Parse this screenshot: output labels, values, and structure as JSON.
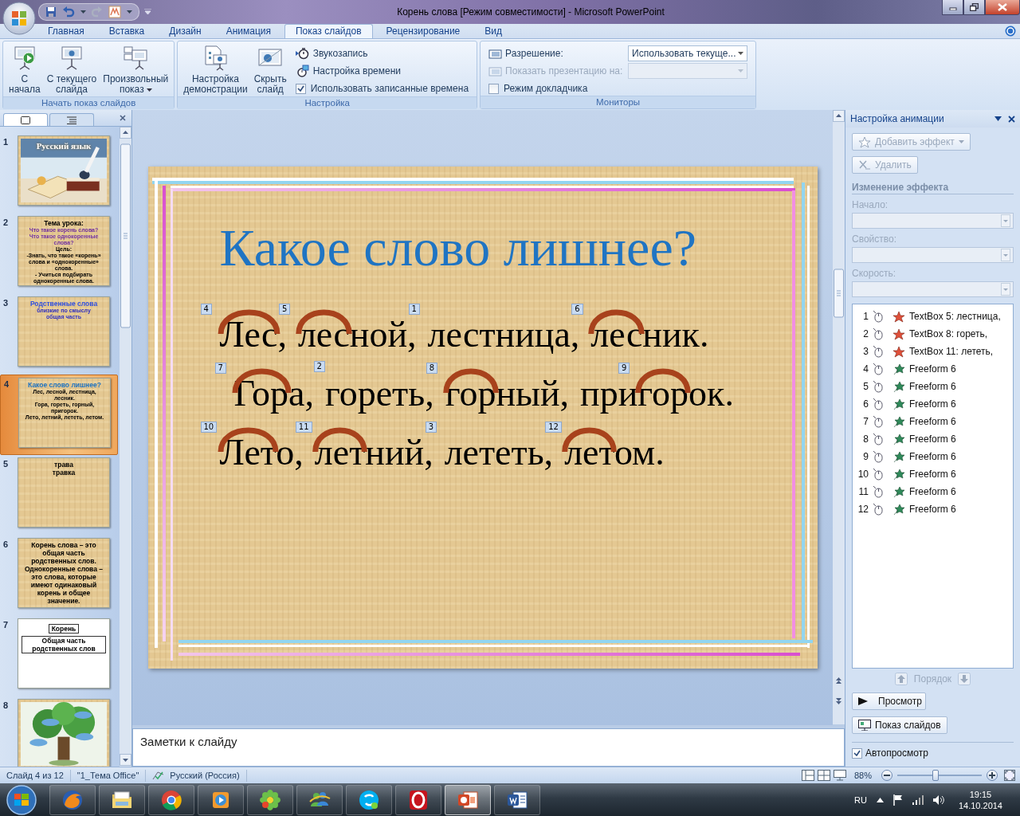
{
  "window": {
    "title": "Корень слова [Режим совместимости] - Microsoft PowerPoint"
  },
  "ribbon": {
    "tabs": [
      {
        "label": "Главная",
        "selected": false
      },
      {
        "label": "Вставка",
        "selected": false
      },
      {
        "label": "Дизайн",
        "selected": false
      },
      {
        "label": "Анимация",
        "selected": false
      },
      {
        "label": "Показ слайдов",
        "selected": true
      },
      {
        "label": "Рецензирование",
        "selected": false
      },
      {
        "label": "Вид",
        "selected": false
      }
    ],
    "groups": [
      {
        "title": "Начать показ слайдов",
        "items": [
          {
            "kind": "large",
            "label": "С\nначала"
          },
          {
            "kind": "large",
            "label": "С текущего\nслайда"
          },
          {
            "kind": "large",
            "label": "Произвольный\nпоказ",
            "dropdown": true
          }
        ]
      },
      {
        "title": "Настройка",
        "items": [
          {
            "kind": "large",
            "label": "Настройка\nдемонстрации"
          },
          {
            "kind": "large",
            "label": "Скрыть\nслайд"
          },
          {
            "kind": "stack",
            "items": [
              {
                "kind": "small",
                "label": "Звукозапись"
              },
              {
                "kind": "small",
                "label": "Настройка времени"
              },
              {
                "kind": "check",
                "label": "Использовать записанные времена",
                "checked": true
              }
            ]
          }
        ]
      },
      {
        "title": "Мониторы",
        "items": [
          {
            "kind": "stack",
            "items": [
              {
                "kind": "select",
                "label": "Разрешение:",
                "value": "Использовать текуще...",
                "disabled": false
              },
              {
                "kind": "select",
                "label": "Показать презентацию на:",
                "disabled": true
              },
              {
                "kind": "check",
                "label": "Режим докладчика",
                "checked": false
              }
            ]
          }
        ]
      }
    ]
  },
  "slides_pane": {
    "tabs": [
      {
        "kind": "slides",
        "selected": true
      },
      {
        "kind": "outline",
        "selected": false
      }
    ],
    "slides": [
      {
        "number": "1",
        "selected": false,
        "kind": "picture",
        "title": "Русский язык"
      },
      {
        "number": "2",
        "selected": false,
        "kind": "text",
        "lines": [
          {
            "text": "Тема урока:",
            "color": "#000000"
          },
          {
            "text": "Что такое корень слова?",
            "color": "#7030a0"
          },
          {
            "text": "Что такое однокоренные слова?",
            "color": "#7030a0"
          },
          {
            "text": "Цель:",
            "color": "#000000"
          },
          {
            "text": "-Знать, что такое «корень» слова и «однокоренные» слова.",
            "color": "#000000"
          },
          {
            "text": "- Учиться подбирать однокоренные слова.",
            "color": "#000000"
          }
        ]
      },
      {
        "number": "3",
        "selected": false,
        "kind": "text",
        "lines": [
          {
            "text": "Родственные слова",
            "color": "#3050e0"
          },
          {
            "text": "близкие по смыслу",
            "color": "#3030c0"
          },
          {
            "text": "общая часть",
            "color": "#3030c0"
          }
        ]
      },
      {
        "number": "4",
        "selected": true,
        "kind": "text",
        "lines": [
          {
            "text": "Какое слово лишнее?",
            "color": "#1f74c3"
          },
          {
            "text": "Лес, лесной, лестница, лесник.",
            "color": "#000000"
          },
          {
            "text": "Гора, гореть, горный, пригорок.",
            "color": "#000000"
          },
          {
            "text": "Лето, летний, лететь, летом.",
            "color": "#000000"
          }
        ]
      },
      {
        "number": "5",
        "selected": false,
        "kind": "text",
        "lines": [
          {
            "text": "трава",
            "color": "#000000"
          },
          {
            "text": "травка",
            "color": "#000000"
          }
        ]
      },
      {
        "number": "6",
        "selected": false,
        "kind": "text",
        "lines": [
          {
            "text": "Корень слова – это общая часть родственных слов.",
            "color": "#000000"
          },
          {
            "text": "Однокоренные слова – это слова, которые имеют одинаковый корень и общее значение.",
            "color": "#000000"
          }
        ]
      },
      {
        "number": "7",
        "selected": false,
        "kind": "boxes",
        "lines": [
          {
            "text": "Корень",
            "color": "#000000"
          },
          {
            "text": "Общая часть родственных слов",
            "color": "#000000"
          }
        ]
      },
      {
        "number": "8",
        "selected": false,
        "kind": "picture"
      }
    ]
  },
  "slide": {
    "title": "Какое слово лишнее?",
    "rows": [
      {
        "words": [
          {
            "parts": [
              {
                "text": "Лес",
                "root": true,
                "tags": [
                  {
                    "number": "4",
                    "after": false
                  }
                ]
              },
              {
                "text": ",",
                "root": false
              }
            ]
          },
          {
            "parts": [
              {
                "text": "лес",
                "root": true,
                "tags": [
                  {
                    "number": "5",
                    "after": false
                  }
                ]
              },
              {
                "text": "ной,",
                "root": false
              }
            ]
          },
          {
            "parts": [
              {
                "text": "лестница,",
                "root": false,
                "tags": [
                  {
                    "number": "1",
                    "after": false
                  }
                ]
              }
            ]
          },
          {
            "parts": [
              {
                "text": "лес",
                "root": true,
                "tags": [
                  {
                    "number": "6",
                    "after": false
                  }
                ]
              },
              {
                "text": "ник.",
                "root": false
              }
            ]
          }
        ]
      },
      {
        "words": [
          {
            "parts": [
              {
                "text": "Гор",
                "root": true,
                "tags": [
                  {
                    "number": "7",
                    "after": false
                  },
                  {
                    "number": "2",
                    "after": true
                  }
                ]
              },
              {
                "text": "а,",
                "root": false
              }
            ]
          },
          {
            "parts": [
              {
                "text": "гореть,",
                "root": false
              }
            ]
          },
          {
            "parts": [
              {
                "text": "гор",
                "root": true,
                "tags": [
                  {
                    "number": "8",
                    "after": false
                  }
                ]
              },
              {
                "text": "ный,",
                "root": false
              }
            ]
          },
          {
            "parts": [
              {
                "text": "при",
                "root": false
              },
              {
                "text": "гор",
                "root": true,
                "tags": [
                  {
                    "number": "9",
                    "after": false
                  }
                ]
              },
              {
                "text": "ок.",
                "root": false
              }
            ]
          }
        ]
      },
      {
        "words": [
          {
            "parts": [
              {
                "text": "Лет",
                "root": true,
                "tags": [
                  {
                    "number": "10",
                    "after": false
                  }
                ]
              },
              {
                "text": "о,",
                "root": false
              }
            ]
          },
          {
            "parts": [
              {
                "text": "лет",
                "root": true,
                "tags": [
                  {
                    "number": "11",
                    "after": false
                  }
                ]
              },
              {
                "text": "ний,",
                "root": false
              }
            ]
          },
          {
            "parts": [
              {
                "text": "лететь,",
                "root": false,
                "tags": [
                  {
                    "number": "3",
                    "after": false
                  }
                ]
              }
            ]
          },
          {
            "parts": [
              {
                "text": "лет",
                "root": true,
                "tags": [
                  {
                    "number": "12",
                    "after": false
                  }
                ]
              },
              {
                "text": "ом.",
                "root": false
              }
            ]
          }
        ]
      }
    ]
  },
  "notes": {
    "placeholder": "Заметки к слайду"
  },
  "animation_pane": {
    "title": "Настройка анимации",
    "add_effect": {
      "label": "Добавить эффект",
      "disabled": true
    },
    "remove": {
      "label": "Удалить",
      "disabled": true
    },
    "section": "Изменение эффекта",
    "fields": [
      {
        "label": "Начало:",
        "disabled": true
      },
      {
        "label": "Свойство:",
        "disabled": true
      },
      {
        "label": "Скорость:",
        "disabled": true
      }
    ],
    "effects": [
      {
        "number": "1",
        "kind": "exit",
        "name": "TextBox 5: лестница,"
      },
      {
        "number": "2",
        "kind": "exit",
        "name": "TextBox 8: гореть,"
      },
      {
        "number": "3",
        "kind": "exit",
        "name": "TextBox 11: лететь,"
      },
      {
        "number": "4",
        "kind": "entrance",
        "name": "Freeform 6"
      },
      {
        "number": "5",
        "kind": "entrance",
        "name": "Freeform 6"
      },
      {
        "number": "6",
        "kind": "entrance",
        "name": "Freeform 6"
      },
      {
        "number": "7",
        "kind": "entrance",
        "name": "Freeform 6"
      },
      {
        "number": "8",
        "kind": "entrance",
        "name": "Freeform 6"
      },
      {
        "number": "9",
        "kind": "entrance",
        "name": "Freeform 6"
      },
      {
        "number": "10",
        "kind": "entrance",
        "name": "Freeform 6"
      },
      {
        "number": "11",
        "kind": "entrance",
        "name": "Freeform 6"
      },
      {
        "number": "12",
        "kind": "entrance",
        "name": "Freeform 6"
      }
    ],
    "order_label": "Порядок",
    "play": {
      "label": "Просмотр"
    },
    "slideshow": {
      "label": "Показ слайдов"
    },
    "autopreview": {
      "label": "Автопросмотр",
      "checked": true
    }
  },
  "status_bar": {
    "slide": "Слайд 4 из 12",
    "theme": "\"1_Тема Office\"",
    "language": "Русский (Россия)",
    "zoom": "88%",
    "zoom_slider": {
      "level": 0.45
    }
  },
  "taskbar": {
    "apps": [
      {
        "kind": "firefox",
        "selected": false
      },
      {
        "kind": "explorer",
        "selected": false
      },
      {
        "kind": "chrome",
        "selected": false
      },
      {
        "kind": "player",
        "selected": false
      },
      {
        "kind": "icq",
        "selected": false
      },
      {
        "kind": "messenger",
        "selected": false
      },
      {
        "kind": "skype",
        "selected": false
      },
      {
        "kind": "opera",
        "selected": false
      },
      {
        "kind": "powerpoint",
        "selected": true
      },
      {
        "kind": "word",
        "selected": false
      }
    ],
    "language": "RU",
    "time": "19:15",
    "date": "14.10.2014"
  }
}
